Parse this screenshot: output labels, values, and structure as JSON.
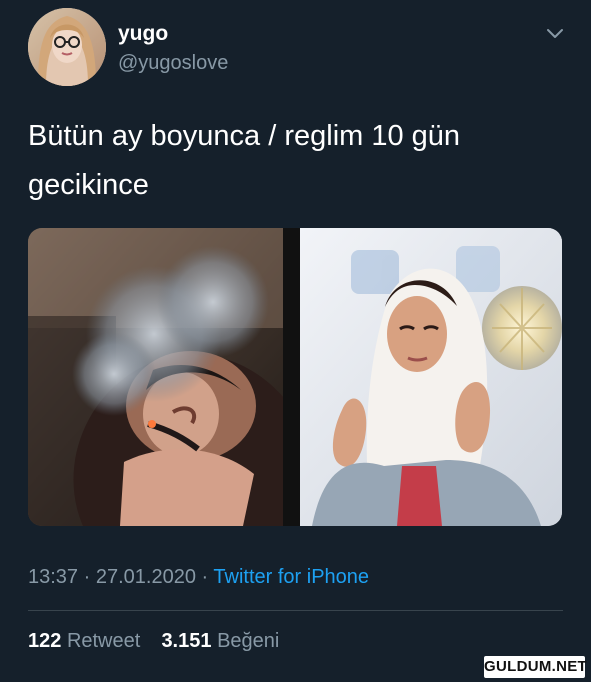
{
  "user": {
    "display_name": "yugo",
    "handle": "@yugoslove"
  },
  "tweet": {
    "text_line1": "Bütün ay boyunca / reglim 10 gün",
    "text_line2": "gecikince",
    "time": "13:37",
    "date": "27.01.2020",
    "separator": "·",
    "source": "Twitter for iPhone"
  },
  "stats": {
    "retweets": "122",
    "retweet_label": "Retweet",
    "likes": "3.151",
    "like_label": "Beğeni"
  },
  "watermark": {
    "text": "GULDUM.NET"
  },
  "colors": {
    "background": "#15202b",
    "text": "#ffffff",
    "muted": "#8899a6",
    "link": "#1da1f2",
    "divider": "#38444d"
  },
  "icons": {
    "menu": "chevron-down-icon"
  }
}
